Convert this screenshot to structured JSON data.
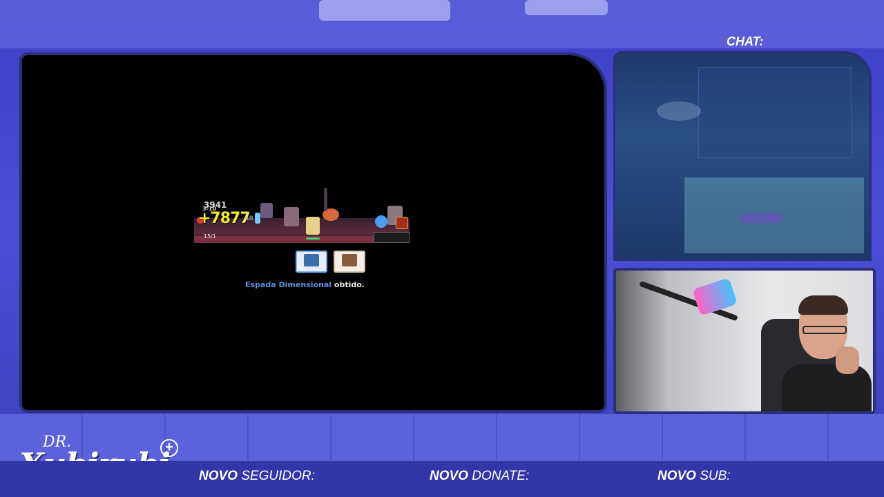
{
  "overlay": {
    "chat_title": "CHAT:",
    "logo": {
      "prefix": "DR.",
      "name": "Xubirubi",
      "badge": "+"
    },
    "alerts": [
      {
        "bold": "NOVO",
        "text": " SEGUIDOR:"
      },
      {
        "bold": "NOVO",
        "text": " DONATE:"
      },
      {
        "bold": "NOVO",
        "text": " SUB:"
      }
    ]
  },
  "game": {
    "damage_main": "+7877",
    "damage_small": "3941",
    "level_label": "3-10",
    "wave_label": "15/1",
    "hit_number": "48",
    "message": {
      "item": "Espada Dimensional",
      "suffix": " obtido."
    }
  },
  "colors": {
    "item_highlight": "#5b8fe0",
    "damage_yellow": "#f3ea32",
    "overlay_blue": "#3d3fc4",
    "frame_border": "#2a2f7a"
  }
}
